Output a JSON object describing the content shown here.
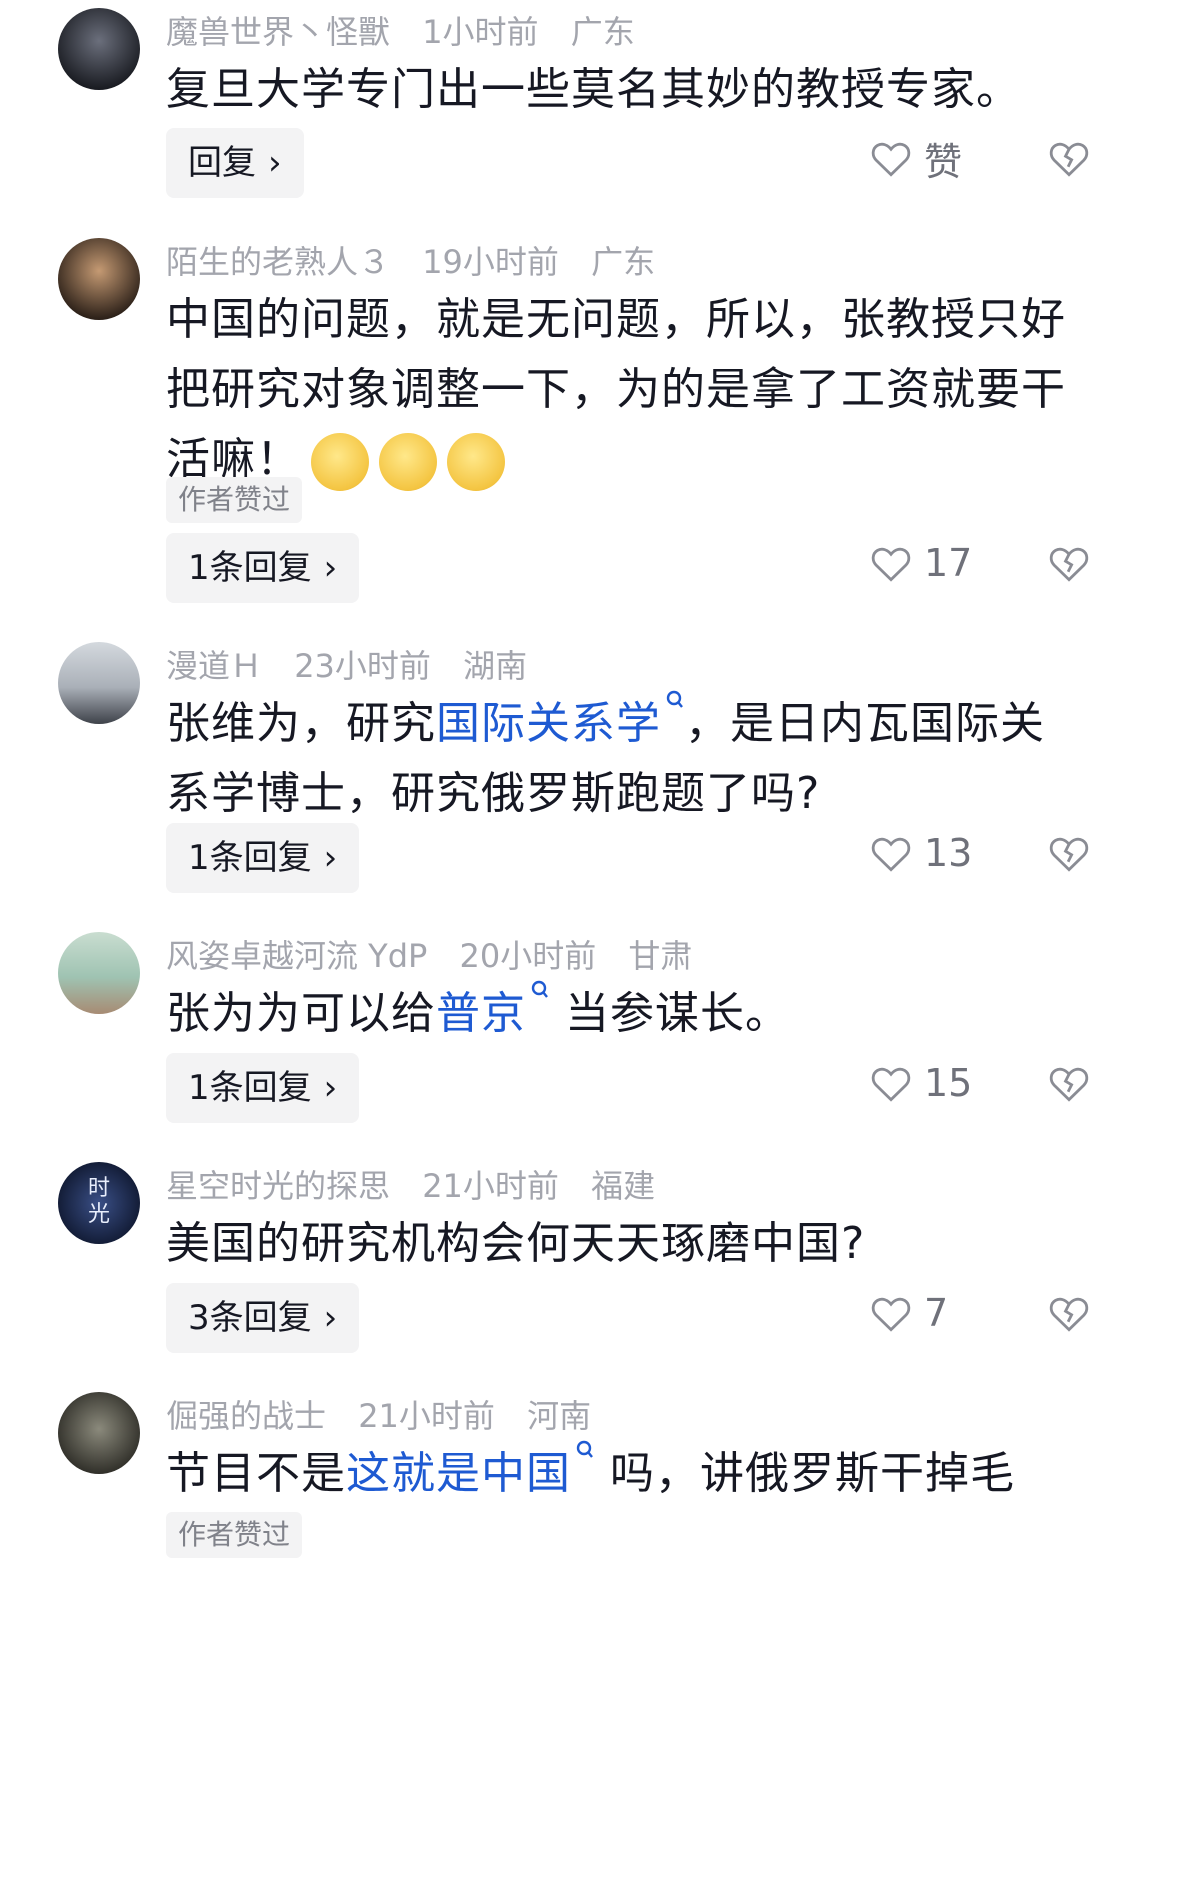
{
  "comments": [
    {
      "user": "魔兽世界丶怪獸",
      "time": "1小时前",
      "region": "广东",
      "segments": [
        {
          "t": "复旦大学专门出一些莫名其妙的教授专家。",
          "link": false
        }
      ],
      "reply_label": "回复",
      "like_label": "赞",
      "author_liked": "",
      "avatar_colors": [
        "#3b3f4a",
        "#1a1c22"
      ]
    },
    {
      "user": "陌生的老熟人３",
      "time": "19小时前",
      "region": "广东",
      "segments": [
        {
          "t": "中国的问题，就是无问题，所以，张教授只好把研究对象调整一下，为的是拿了工资就要干活嘛！",
          "link": false
        }
      ],
      "emoji_count": 3,
      "reply_label": "1条回复",
      "like_label": "17",
      "author_liked": "作者赞过",
      "avatar_colors": [
        "#8a6a4a",
        "#2d2119"
      ]
    },
    {
      "user": "漫道Ｈ",
      "time": "23小时前",
      "region": "湖南",
      "segments": [
        {
          "t": "张维为，研究",
          "link": false
        },
        {
          "t": "国际关系学",
          "link": true
        },
        {
          "t": "，是日内瓦国际关系学博士，研究俄罗斯跑题了吗?",
          "link": false
        }
      ],
      "reply_label": "1条回复",
      "like_label": "13",
      "author_liked": "",
      "avatar_colors": [
        "#c7ccd2",
        "#4a4e55"
      ]
    },
    {
      "user": "风姿卓越河流 YdP",
      "time": "20小时前",
      "region": "甘肃",
      "segments": [
        {
          "t": "张为为可以给",
          "link": false
        },
        {
          "t": "普京",
          "link": true
        },
        {
          "t": "当参谋长。",
          "link": false
        }
      ],
      "reply_label": "1条回复",
      "like_label": "15",
      "author_liked": "",
      "avatar_colors": [
        "#b9d3c4",
        "#a78b73"
      ]
    },
    {
      "user": "星空时光的探思",
      "time": "21小时前",
      "region": "福建",
      "segments": [
        {
          "t": "美国的研究机构会何天天琢磨中国?",
          "link": false
        }
      ],
      "avatar_text": [
        "时",
        "光"
      ],
      "reply_label": "3条回复",
      "like_label": "7",
      "author_liked": "",
      "avatar_colors": [
        "#3a4f86",
        "#111a33"
      ]
    },
    {
      "user": "倔强的战士",
      "time": "21小时前",
      "region": "河南",
      "segments": [
        {
          "t": "节目不是",
          "link": false
        },
        {
          "t": "这就是中国",
          "link": true
        },
        {
          "t": "吗，讲俄罗斯干掉毛",
          "link": false
        }
      ],
      "reply_label": "",
      "like_label": "",
      "author_liked": "作者赞过",
      "avatar_colors": [
        "#6b6a5e",
        "#2f2e28"
      ]
    }
  ],
  "colors": {
    "link": "#1e5ad2",
    "meta": "#a3a5ad",
    "text": "#161823"
  }
}
